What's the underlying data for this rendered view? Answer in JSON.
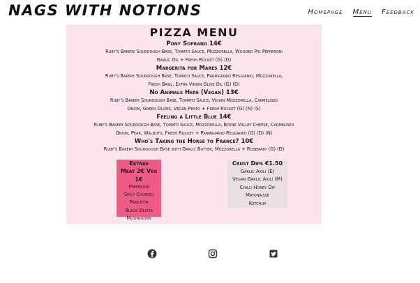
{
  "site": {
    "title": "NAGS WITH NOTIONS"
  },
  "nav": {
    "items": [
      "Homepage",
      "Menu",
      "Feedback"
    ],
    "active": "Menu"
  },
  "menu": {
    "title": "PIZZA MENU",
    "pizzas": [
      {
        "name": "Pony Soprano 14€",
        "desc1": "Ruby's Bakery Sourdough Base, Tomato Sauce, Mozzorella, Wooded Pig Pepperoni",
        "desc2": "Garlic Oil + Fresh Rocket (G) (D)"
      },
      {
        "name": "Margerita for Mares 12€",
        "desc1": "Ruby's Bakery Sourdough Base, Tomato Sauce, Parmigianio Reggianio, Mozzorella,",
        "desc2": "Fresh Basil, Extra Virgin Olive Oil (G) (D)"
      },
      {
        "name": "No Animals Here (Vegan) 13€",
        "desc1": "Ruby's Bakery Sourdough Base, Tomato Sauce, Vegan Mozzorella, Carmelised",
        "desc2": "Onion, Green Olives, Vegan Pesto + Fresh Rocket (G) (N) (S)"
      },
      {
        "name": "Feeling a Little Blue 14€",
        "desc1": "Ruby's Bakery Sourdough Base, Tomato Sauce, Mozzorella, Boyne Valley Cheese, Carmelised",
        "desc2": "Onion, Pear, Walnuts, Fresh Rocket + Parmigianio Reggianio (G) (D) (N)"
      },
      {
        "name": "Who's Taking the Horse to France? 10€",
        "desc1": "Ruby's Bakery Sourdough Base with Garlic Butter, Mozzorella + Rosemary (G) (D)",
        "desc2": ""
      }
    ],
    "extras": {
      "heading": "Extras",
      "subheading": "Meat 2€ Veg 1€",
      "items": [
        "Pepperoni",
        "Spicy Chorizo",
        "Pancetta",
        "Black Olives",
        "Mushrooms"
      ]
    },
    "dips": {
      "heading": "Crust Dips €1.50",
      "items": [
        "Garlic Aioli (E)",
        "Vegan Garlic Aioli (M)",
        "Chilli Honey Dip",
        "Mayonaisse",
        "Ketchup"
      ]
    }
  },
  "social": {
    "icons": [
      "facebook-icon",
      "instagram-icon",
      "twitter-icon"
    ]
  },
  "colors": {
    "menu_bg": "#fce4ec",
    "extras_bg": "#ef5b87",
    "dips_bg": "#eadfe2"
  }
}
